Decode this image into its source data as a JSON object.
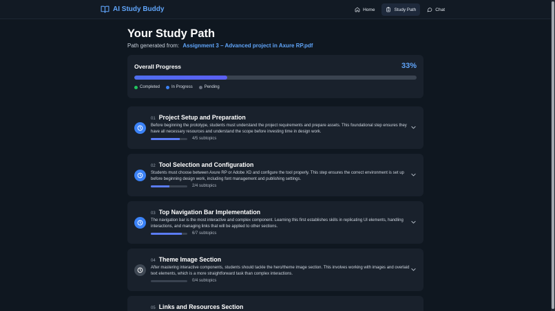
{
  "app": {
    "name": "AI Study Buddy"
  },
  "nav": [
    {
      "label": "Home",
      "icon": "home-icon"
    },
    {
      "label": "Study Path",
      "icon": "clipboard-icon",
      "active": true
    },
    {
      "label": "Chat",
      "icon": "chat-bubble-icon"
    }
  ],
  "page": {
    "title": "Your Study Path",
    "subtitle_prefix": "Path generated from:",
    "source_file": "Assignment 3 – Advanced project in Axure RP.pdf"
  },
  "progress": {
    "title": "Overall Progress",
    "percent_label": "33%",
    "percent": 33,
    "legend": [
      {
        "label": "Completed",
        "color": "#22c55e"
      },
      {
        "label": "In Progress",
        "color": "#3b82f6"
      },
      {
        "label": "Pending",
        "color": "#6b7280"
      }
    ]
  },
  "steps": [
    {
      "number": "01",
      "title": "Project Setup and Preparation",
      "description": "Before beginning the prototype, students must understand the project requirements and prepare assets. This foundational step ensures they have all necessary resources and understand the scope before investing time in design work.",
      "done": 4,
      "total": 5,
      "subtopics_label": "4/5 subtopics",
      "status": "inprogress"
    },
    {
      "number": "02",
      "title": "Tool Selection and Configuration",
      "description": "Students must choose between Axure RP or Adobe XD and configure the tool properly. This step ensures the correct environment is set up before beginning design work, including font management and publishing settings.",
      "done": 2,
      "total": 4,
      "subtopics_label": "2/4 subtopics",
      "status": "inprogress"
    },
    {
      "number": "03",
      "title": "Top Navigation Bar Implementation",
      "description": "The navigation bar is the most interactive and complex component. Learning this first establishes skills in replicating UI elements, handling interactions, and managing links that will be applied to other sections.",
      "done": 6,
      "total": 7,
      "subtopics_label": "6/7 subtopics",
      "status": "inprogress"
    },
    {
      "number": "04",
      "title": "Theme Image Section",
      "description": "After mastering interactive components, students should tackle the hero/theme image section. This involves working with images and overlaid text elements, which is a more straightforward task than complex interactions.",
      "done": 0,
      "total": 4,
      "subtopics_label": "0/4 subtopics",
      "status": "pending"
    },
    {
      "number": "05",
      "title": "Links and Resources Section",
      "description": "",
      "done": 0,
      "total": 0,
      "subtopics_label": "",
      "status": "pending"
    }
  ]
}
